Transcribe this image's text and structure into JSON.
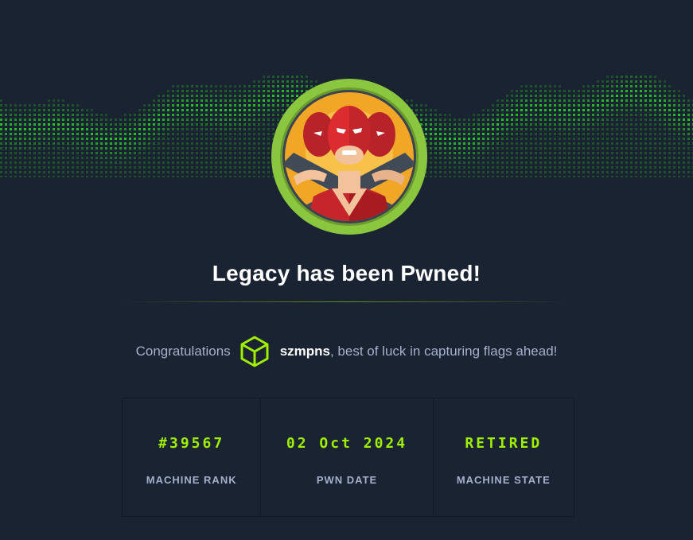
{
  "banner": {
    "icon": "pixel-wave-banner"
  },
  "avatar": {
    "icon": "machine-avatar-legacy",
    "ring_color": "#8ac73e"
  },
  "title": "Legacy has been Pwned!",
  "message": {
    "prefix": "Congratulations",
    "icon": "user-cube-icon",
    "username": "szmpns",
    "suffix": ", best of luck in capturing flags ahead!"
  },
  "stats": [
    {
      "value": "#39567",
      "label": "MACHINE RANK"
    },
    {
      "value": "02 Oct 2024",
      "label": "PWN DATE"
    },
    {
      "value": "RETIRED",
      "label": "MACHINE STATE"
    }
  ],
  "colors": {
    "background": "#1a2332",
    "accent": "#9fef00",
    "muted_text": "#a4b1cd"
  }
}
